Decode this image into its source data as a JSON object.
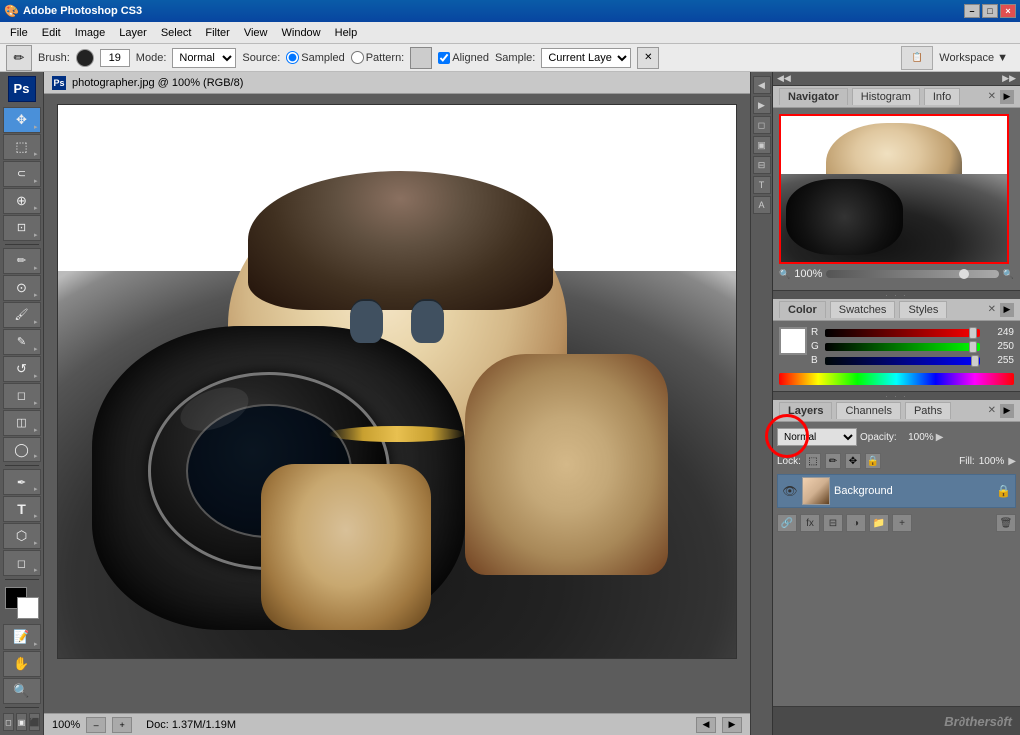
{
  "app": {
    "title": "Adobe Photoshop CS3",
    "title_icon": "Ps"
  },
  "title_bar": {
    "title": "Adobe Photoshop CS3",
    "minimize": "–",
    "maximize": "□",
    "close": "×"
  },
  "menu": {
    "items": [
      "File",
      "Edit",
      "Image",
      "Layer",
      "Select",
      "Filter",
      "View",
      "Window",
      "Help"
    ]
  },
  "options_bar": {
    "brush_label": "Brush:",
    "brush_size": "19",
    "mode_label": "Mode:",
    "mode_value": "Normal",
    "source_label": "Source:",
    "sampled_label": "Sampled",
    "pattern_label": "Pattern:",
    "aligned_label": "Aligned",
    "sample_label": "Sample:",
    "sample_value": "Current Layer"
  },
  "canvas": {
    "tab_title": "photographer.jpg @ 100% (RGB/8)",
    "zoom": "100%",
    "doc_info": "Doc: 1.37M/1.19M"
  },
  "navigator_panel": {
    "tabs": [
      "Navigator",
      "Histogram",
      "Info"
    ],
    "active_tab": "Navigator",
    "zoom_value": "100%"
  },
  "color_panel": {
    "tabs": [
      "Color",
      "Swatches",
      "Styles"
    ],
    "active_tab": "Color",
    "r_label": "R",
    "r_value": "249",
    "g_label": "G",
    "g_value": "250",
    "b_label": "B",
    "b_value": "255"
  },
  "layers_panel": {
    "tabs": [
      "Layers",
      "Channels",
      "Paths"
    ],
    "active_tab": "Layers",
    "mode_value": "Normal",
    "opacity_label": "Opacity:",
    "opacity_value": "100%",
    "lock_label": "Lock:",
    "fill_label": "Fill:",
    "fill_value": "100%",
    "layers": [
      {
        "name": "Background",
        "visible": true,
        "locked": true
      }
    ]
  },
  "watermark": "Br∂thers∂ft",
  "tools": [
    {
      "name": "move",
      "icon": "✥"
    },
    {
      "name": "marquee",
      "icon": "⬚"
    },
    {
      "name": "lasso",
      "icon": "⌀"
    },
    {
      "name": "quick-select",
      "icon": "⊕"
    },
    {
      "name": "crop",
      "icon": "⊡"
    },
    {
      "name": "eyedropper",
      "icon": "🖉"
    },
    {
      "name": "spot-heal",
      "icon": "⊙"
    },
    {
      "name": "brush",
      "icon": "🖌"
    },
    {
      "name": "clone-stamp",
      "icon": "✎"
    },
    {
      "name": "eraser",
      "icon": "◻"
    },
    {
      "name": "gradient",
      "icon": "◫"
    },
    {
      "name": "dodge",
      "icon": "◯"
    },
    {
      "name": "pen",
      "icon": "✒"
    },
    {
      "name": "text",
      "icon": "T"
    },
    {
      "name": "selection",
      "icon": "⬡"
    },
    {
      "name": "shape",
      "icon": "◻"
    },
    {
      "name": "notes",
      "icon": "🗒"
    },
    {
      "name": "eyedropper2",
      "icon": "✏"
    },
    {
      "name": "hand",
      "icon": "✋"
    },
    {
      "name": "zoom",
      "icon": "🔍"
    }
  ]
}
